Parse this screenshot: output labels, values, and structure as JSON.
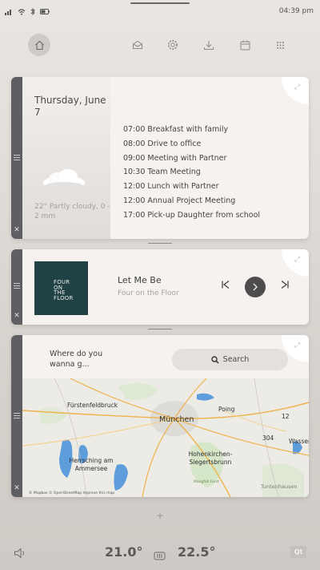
{
  "status_bar": {
    "time": "04:39 pm",
    "icons": [
      "signal-icon",
      "wifi-icon",
      "bluetooth-icon",
      "battery-icon"
    ]
  },
  "nav": {
    "items": [
      "home-icon",
      "mail-icon",
      "settings-icon",
      "download-icon",
      "calendar-icon",
      "apps-grid-icon"
    ],
    "active": "home-icon"
  },
  "calendar": {
    "date": "Thursday, June 7",
    "weather": "22° Partly cloudy, 0 - 2 mm",
    "events": [
      "07:00 Breakfast with family",
      "08:00 Drive to office",
      "09:00 Meeting with Partner",
      "10:30 Team Meeting",
      "12:00 Lunch with Partner",
      "12:00 Annual Project Meeting",
      "17:00 Pick-up Daughter from school"
    ]
  },
  "music": {
    "album_art_text": "FOUR ON THE FLOOR",
    "title": "Let Me Be",
    "artist": "Four on the Floor"
  },
  "map": {
    "question": "Where do you wanna g...",
    "search_label": "Search",
    "labels": {
      "fuerstenfeldbruck": "Fürstenfeldbruck",
      "muenchen": "München",
      "poing": "Poing",
      "herrsching": "Herrsching am Ammersee",
      "hohenkirchen": "Hohenkirchen-Siegertsbrunn",
      "wasser": "Wasser",
      "tuntenhausen": "Tuntenhausen",
      "road_12": "12",
      "road_304": "304",
      "mangfall": "Mangfall Forst"
    },
    "attribution": "© Mapbox © OpenStreetMap Improve this map"
  },
  "climate": {
    "temp_left": "21.0°",
    "temp_right": "22.5°",
    "brand": "Qt"
  },
  "colors": {
    "rail": "#5f5f63",
    "card": "#f5f2ef",
    "play_button": "#4e4c4d",
    "album": "#214244",
    "lake": "#5d9ddb",
    "road": "#f0b24a"
  }
}
